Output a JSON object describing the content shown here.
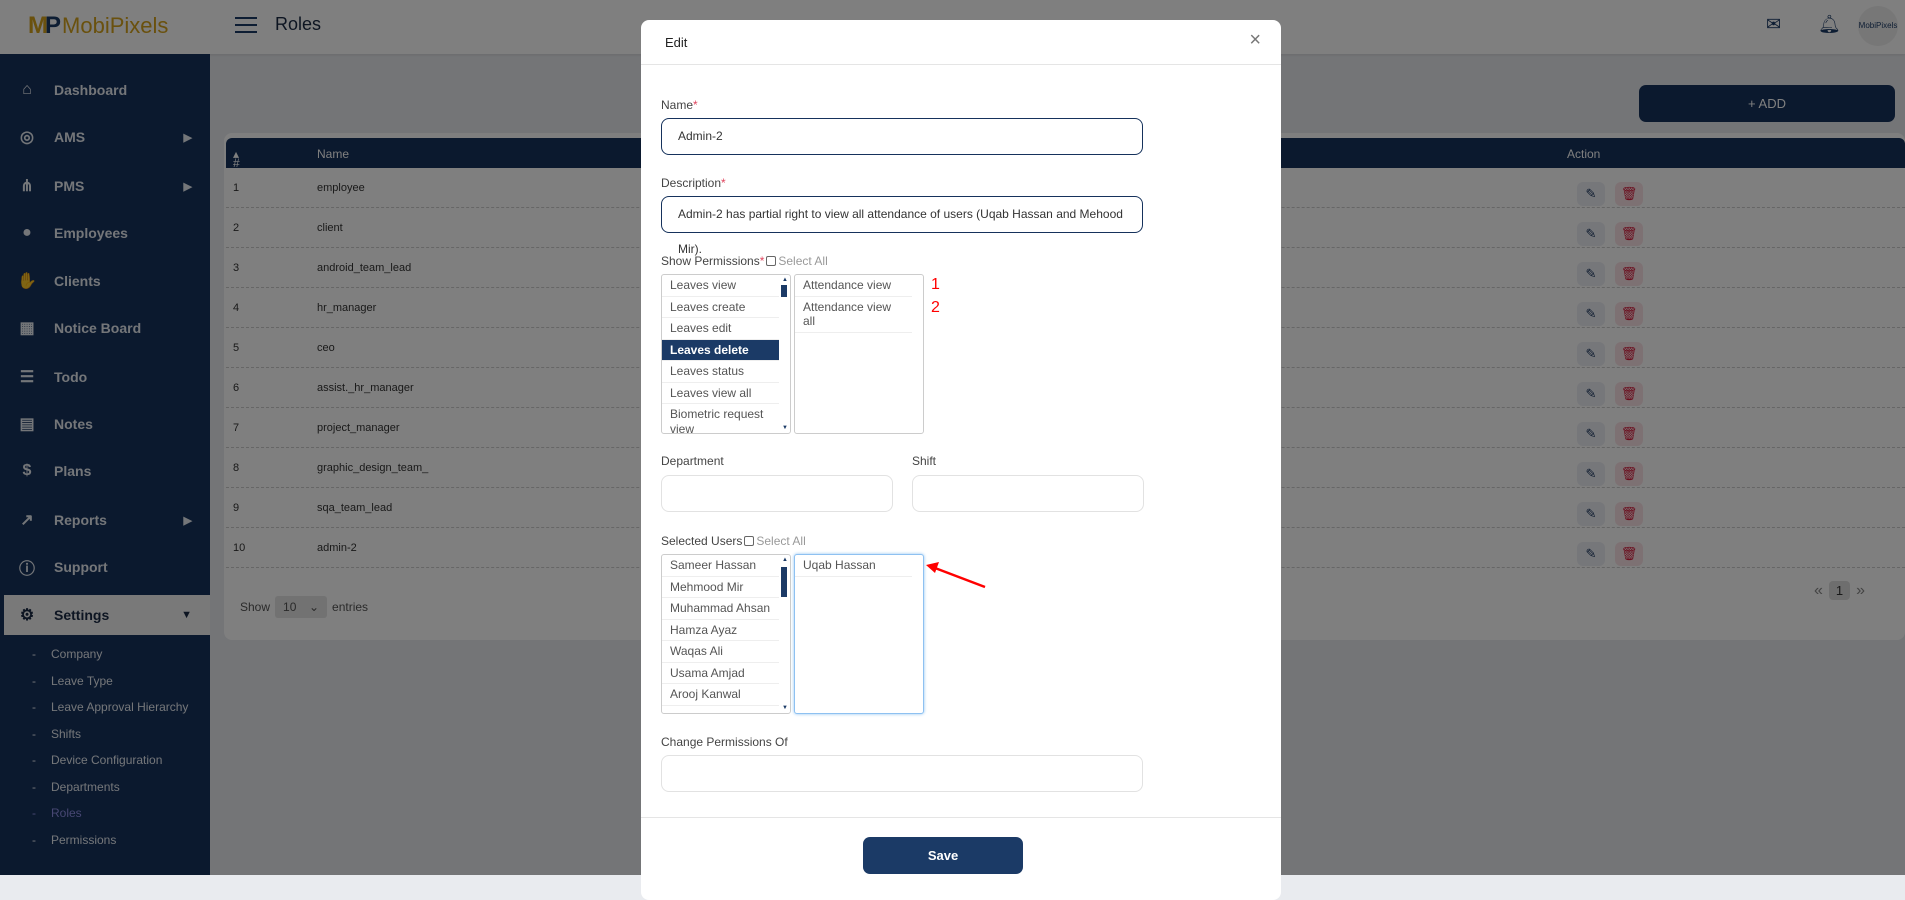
{
  "header": {
    "logo": "MobiPixels",
    "title": "Roles",
    "icons": [
      "mail-icon",
      "bell-icon"
    ],
    "avatar_text": "MobiPixels"
  },
  "sidebar": {
    "items": [
      {
        "label": "Dashboard",
        "icon": "home-icon"
      },
      {
        "label": "AMS",
        "icon": "fingerprint-icon",
        "arrow": true
      },
      {
        "label": "PMS",
        "icon": "network-icon",
        "arrow": true
      },
      {
        "label": "Employees",
        "icon": "user-icon"
      },
      {
        "label": "Clients",
        "icon": "handshake-icon"
      },
      {
        "label": "Notice Board",
        "icon": "calendar-icon"
      },
      {
        "label": "Todo",
        "icon": "checklist-icon"
      },
      {
        "label": "Notes",
        "icon": "note-icon"
      },
      {
        "label": "Plans",
        "icon": "dollar-icon"
      },
      {
        "label": "Reports",
        "icon": "chart-icon",
        "arrow": true
      },
      {
        "label": "Support",
        "icon": "info-icon"
      },
      {
        "label": "Settings",
        "icon": "gear-icon",
        "active": true
      }
    ],
    "sub_items": [
      "Company",
      "Leave Type",
      "Leave Approval Hierarchy",
      "Shifts",
      "Device Configuration",
      "Departments",
      "Roles",
      "Permissions"
    ],
    "current_sub": "Roles"
  },
  "main": {
    "add_label": "+ ADD",
    "columns": [
      "#",
      "Name",
      "Action"
    ],
    "rows": [
      {
        "n": "1",
        "name": "employee"
      },
      {
        "n": "2",
        "name": "client"
      },
      {
        "n": "3",
        "name": "android_team_lead"
      },
      {
        "n": "4",
        "name": "hr_manager"
      },
      {
        "n": "5",
        "name": "ceo"
      },
      {
        "n": "6",
        "name": "assist._hr_manager"
      },
      {
        "n": "7",
        "name": "project_manager"
      },
      {
        "n": "8",
        "name": "graphic_design_team_"
      },
      {
        "n": "9",
        "name": "sqa_team_lead"
      },
      {
        "n": "10",
        "name": "admin-2"
      }
    ],
    "show_label": "Show",
    "entries_value": "10",
    "entries_label": "entries",
    "page": "1",
    "prev": "«",
    "next": "»"
  },
  "modal": {
    "title": "Edit",
    "close": "×",
    "name_label": "Name",
    "name_value": "Admin-2",
    "required": "*",
    "desc_label": "Description",
    "desc_value": "Admin-2 has partial right to view all attendance of users (Uqab Hassan and Mehood Mir).",
    "perm_label": "Show Permissions",
    "select_all": "Select All",
    "available_permissions": [
      "Leaves view",
      "Leaves create",
      "Leaves edit",
      "Leaves delete",
      "Leaves status",
      "Leaves view all",
      "Biometric request view"
    ],
    "highlighted_permission": "Leaves delete",
    "selected_permissions": [
      "Attendance view",
      "Attendance view all"
    ],
    "annotations": [
      "1",
      "2"
    ],
    "dept_label": "Department",
    "shift_label": "Shift",
    "dept_value": "",
    "shift_value": "",
    "users_label": "Selected Users",
    "available_users": [
      "Sameer Hassan",
      "Mehmood Mir",
      "Muhammad Ahsan",
      "Hamza Ayaz",
      "Waqas Ali",
      "Usama Amjad",
      "Arooj Kanwal"
    ],
    "selected_users": [
      "Uqab Hassan"
    ],
    "change_label": "Change Permissions Of",
    "change_value": "",
    "save_label": "Save",
    "annotation_color": "#ff0000",
    "brand_color": "#1b3a66"
  }
}
